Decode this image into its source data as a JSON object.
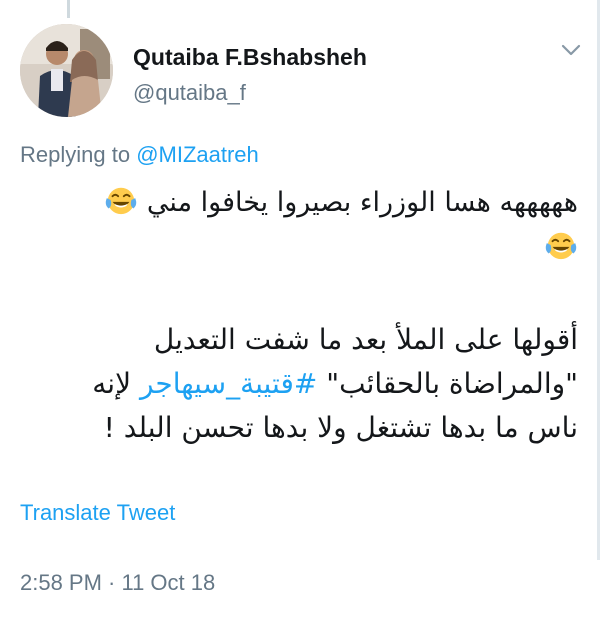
{
  "tweet": {
    "display_name": "Qutaiba F.Bshabsheh",
    "handle": "@qutaiba_f",
    "replying_prefix": "Replying to ",
    "replying_to": "@MIZaatreh",
    "line1_text": "هههههه هسا الوزراء بصيروا يخافوا مني",
    "para_line1": "أقولها على الملأ بعد ما شفت التعديل",
    "para_line2_start": "\"والمراضاة بالحقائب\" ",
    "para_line2_hashtag": "#قتيبة_سيهاجر",
    "para_line2_end": " لإنه",
    "para_line3": "ناس ما بدها تشتغل ولا بدها تحسن البلد !",
    "emoji_name": "face-with-tears-of-joy-icon",
    "translate_label": "Translate Tweet",
    "timestamp": "2:58 PM · 11 Oct 18"
  },
  "colors": {
    "link": "#1da1f2",
    "secondary_text": "#657786",
    "primary_text": "#14171a"
  }
}
